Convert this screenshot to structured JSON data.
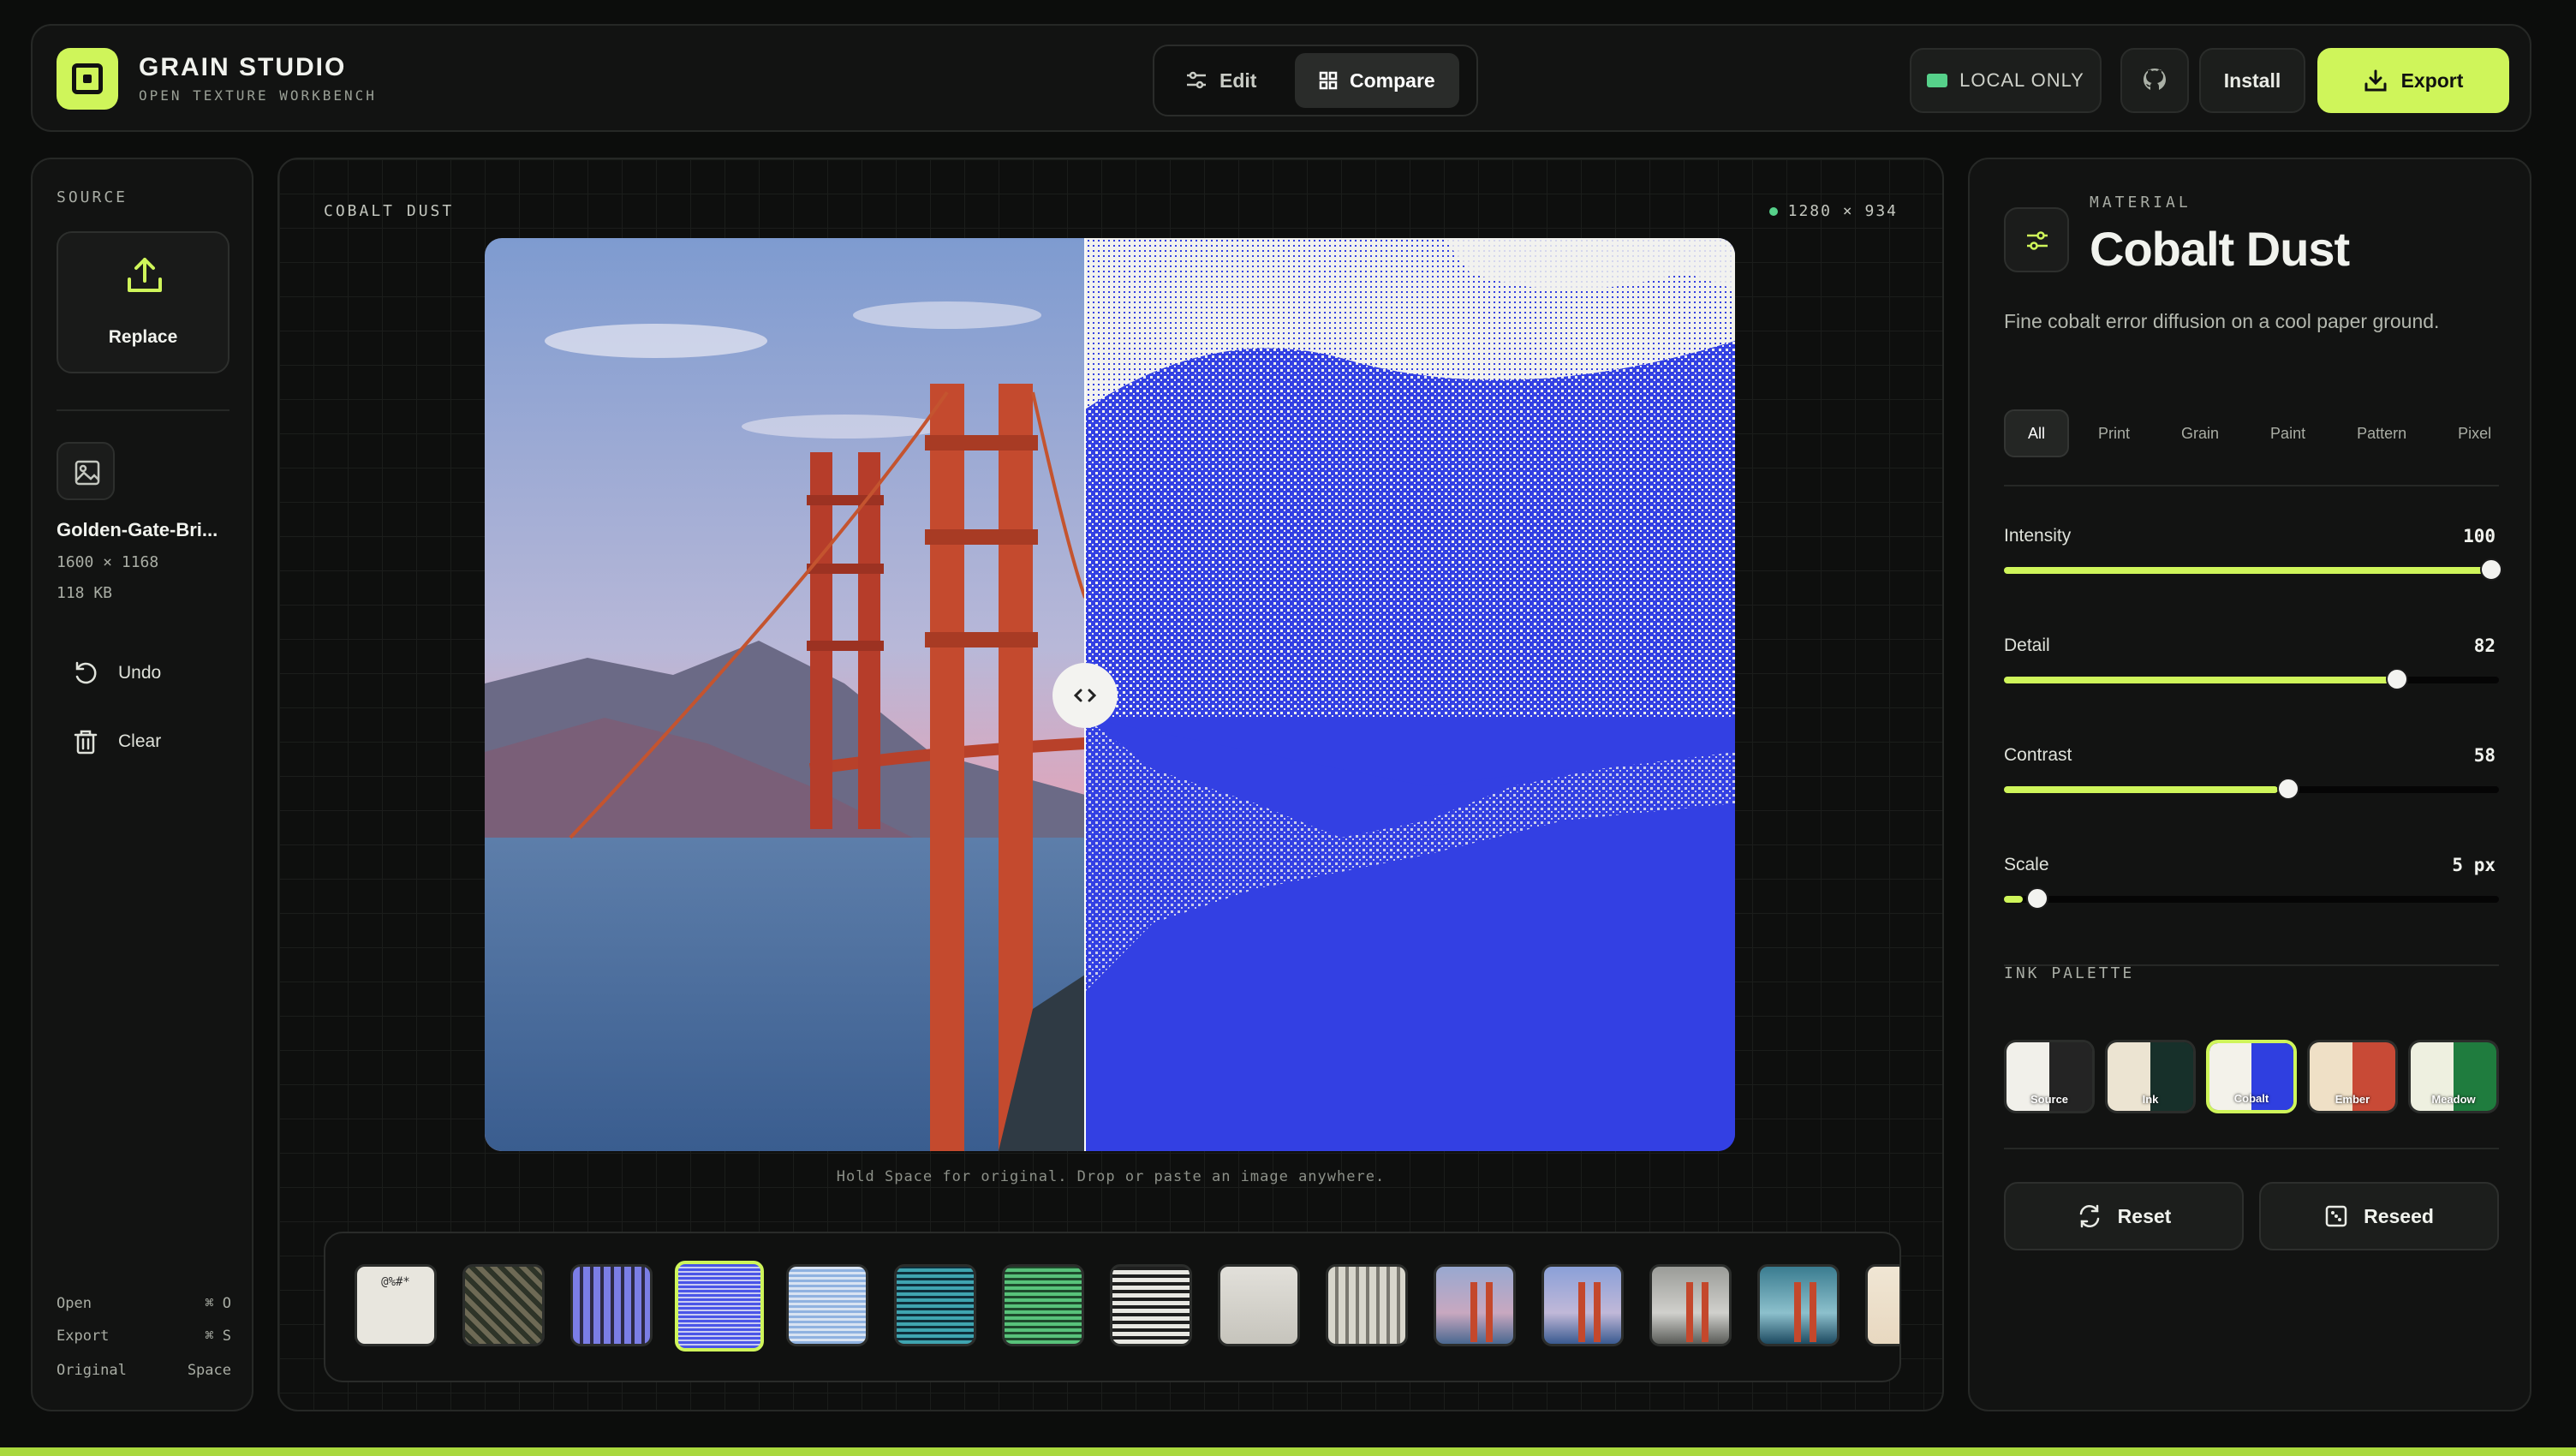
{
  "header": {
    "app_title": "GRAIN STUDIO",
    "app_subtitle": "OPEN TEXTURE WORKBENCH",
    "mode_edit": "Edit",
    "mode_compare": "Compare",
    "local_only": "LOCAL ONLY",
    "install": "Install",
    "export": "Export"
  },
  "source": {
    "label": "SOURCE",
    "replace": "Replace",
    "file_name": "Golden-Gate-Bri...",
    "dimensions": "1600 × 1168",
    "size": "118 KB",
    "undo": "Undo",
    "clear": "Clear",
    "shortcuts": [
      {
        "label": "Open",
        "key": "⌘ O"
      },
      {
        "label": "Export",
        "key": "⌘ S"
      },
      {
        "label": "Original",
        "key": "Space"
      }
    ]
  },
  "canvas": {
    "title": "COBALT DUST",
    "dimensions": "1280 × 934",
    "hint": "Hold Space for original. Drop or paste an image anywhere.",
    "split_fraction": 0.48,
    "effect_color": "#3340e3"
  },
  "presets": [
    {
      "name": "ascii",
      "selected": false
    },
    {
      "name": "mosaic",
      "selected": false
    },
    {
      "name": "cross-stitch",
      "selected": false
    },
    {
      "name": "cobalt",
      "selected": true
    },
    {
      "name": "blueprint",
      "selected": false
    },
    {
      "name": "teal",
      "selected": false
    },
    {
      "name": "meadow",
      "selected": false
    },
    {
      "name": "halftone",
      "selected": false
    },
    {
      "name": "fog",
      "selected": false
    },
    {
      "name": "weave",
      "selected": false
    },
    {
      "name": "bridge-warm",
      "selected": false
    },
    {
      "name": "bridge-cool",
      "selected": false
    },
    {
      "name": "bridge-mono",
      "selected": false
    },
    {
      "name": "bridge-teal",
      "selected": false
    },
    {
      "name": "bridge-paper",
      "selected": false
    }
  ],
  "material": {
    "label": "MATERIAL",
    "name": "Cobalt Dust",
    "description": "Fine cobalt error diffusion on a cool paper ground.",
    "tabs": [
      "All",
      "Print",
      "Grain",
      "Paint",
      "Pattern",
      "Pixel"
    ],
    "active_tab": "All",
    "sliders": [
      {
        "label": "Intensity",
        "value": "100",
        "fraction": 1.0
      },
      {
        "label": "Detail",
        "value": "82",
        "fraction": 0.8
      },
      {
        "label": "Contrast",
        "value": "58",
        "fraction": 0.57
      },
      {
        "label": "Scale",
        "value": "5 px",
        "fraction": 0.04
      }
    ],
    "ink_label": "INK PALETTE",
    "inks": [
      {
        "name": "Source",
        "left": "#f1f0ea",
        "right": "#242424",
        "selected": false
      },
      {
        "name": "Ink",
        "left": "#ece4d2",
        "right": "#17302a",
        "selected": false
      },
      {
        "name": "Cobalt",
        "left": "#f3f2ea",
        "right": "#2f3fe0",
        "selected": true
      },
      {
        "name": "Ember",
        "left": "#efe0c6",
        "right": "#c84a36",
        "selected": false
      },
      {
        "name": "Meadow",
        "left": "#eef0e0",
        "right": "#1f7c3e",
        "selected": false
      }
    ],
    "reset": "Reset",
    "reseed": "Reseed"
  },
  "colors": {
    "accent": "#cff55a",
    "status": "#56d18a"
  }
}
